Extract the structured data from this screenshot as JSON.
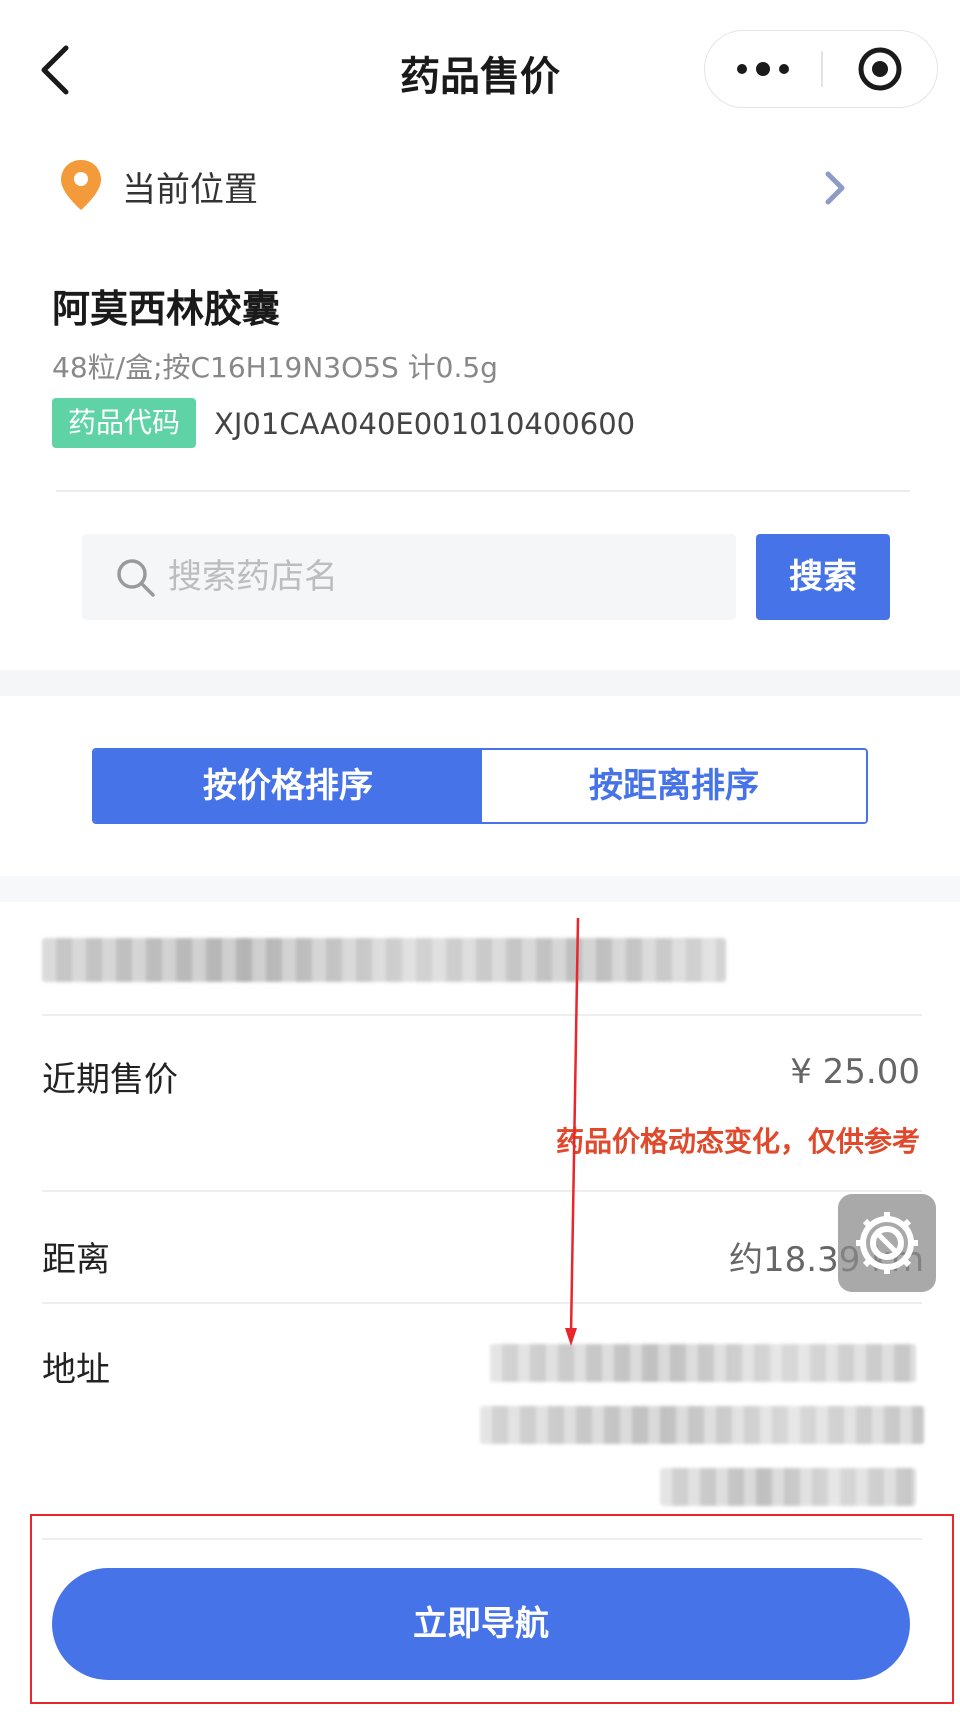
{
  "nav": {
    "title": "药品售价",
    "back_icon": "chevron-left-icon",
    "more_icon": "more-dots-icon",
    "close_icon": "target-close-icon"
  },
  "location": {
    "label": "当前位置",
    "pin_color": "#f39a3a",
    "icon": "location-pin-icon"
  },
  "drug": {
    "name": "阿莫西林胶囊",
    "spec": "48粒/盒;按C16H19N3O5S 计0.5g",
    "code_tag": "药品代码",
    "code_value": "XJ01CAA040E001010400600"
  },
  "search": {
    "placeholder": "搜索药店名",
    "value": "",
    "button_label": "搜索"
  },
  "sort": {
    "tabs": [
      {
        "label": "按价格排序",
        "active": true
      },
      {
        "label": "按距离排序",
        "active": false
      }
    ]
  },
  "pharmacy": {
    "price_label": "近期售价",
    "price_value": "¥ 25.00",
    "price_note": "药品价格动态变化，仅供参考",
    "distance_label": "距离",
    "distance_value": "约18.39 km",
    "address_label": "地址"
  },
  "navigate_button": {
    "label": "立即导航"
  },
  "colors": {
    "primary": "#4773e8",
    "code_tag_bg": "#5fd3a6",
    "warning": "#e0492c",
    "annotation": "#e8262c"
  }
}
